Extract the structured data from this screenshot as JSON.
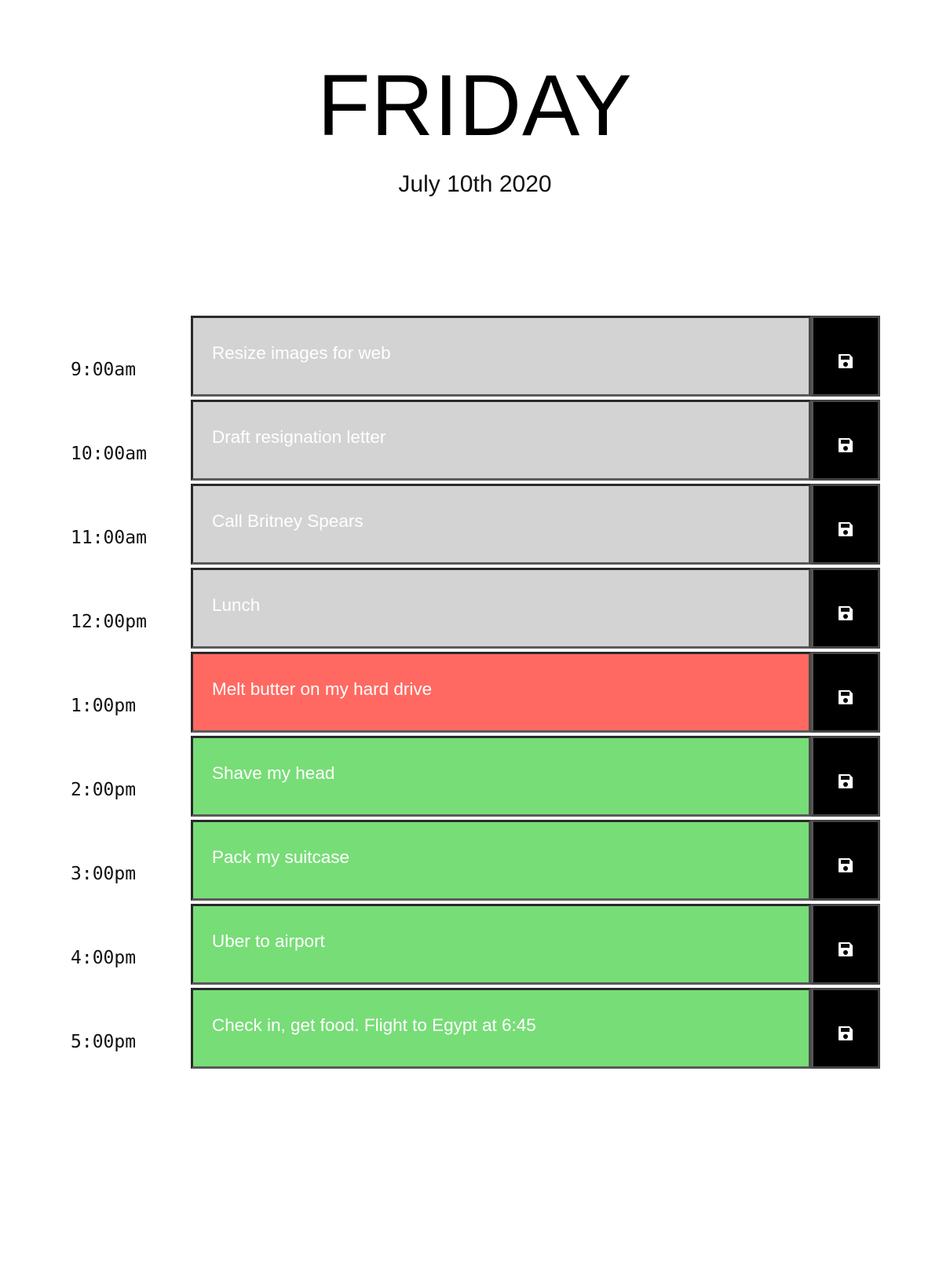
{
  "header": {
    "day": "FRIDAY",
    "date": "July 10th 2020"
  },
  "colors": {
    "past": "#d3d3d3",
    "present": "#ff6961",
    "future": "#77dd77",
    "save_button": "#000000"
  },
  "icons": {
    "save": "floppy-disk-icon"
  },
  "rows": [
    {
      "hour": "9:00am",
      "task": "Resize images for web",
      "state": "past"
    },
    {
      "hour": "10:00am",
      "task": "Draft resignation letter",
      "state": "past"
    },
    {
      "hour": "11:00am",
      "task": "Call Britney Spears",
      "state": "past"
    },
    {
      "hour": "12:00pm",
      "task": "Lunch",
      "state": "past"
    },
    {
      "hour": "1:00pm",
      "task": "Melt butter on my hard drive",
      "state": "present"
    },
    {
      "hour": "2:00pm",
      "task": "Shave my head",
      "state": "future"
    },
    {
      "hour": "3:00pm",
      "task": "Pack my suitcase",
      "state": "future"
    },
    {
      "hour": "4:00pm",
      "task": "Uber to airport",
      "state": "future"
    },
    {
      "hour": "5:00pm",
      "task": "Check in, get food. Flight to Egypt at 6:45",
      "state": "future"
    }
  ]
}
